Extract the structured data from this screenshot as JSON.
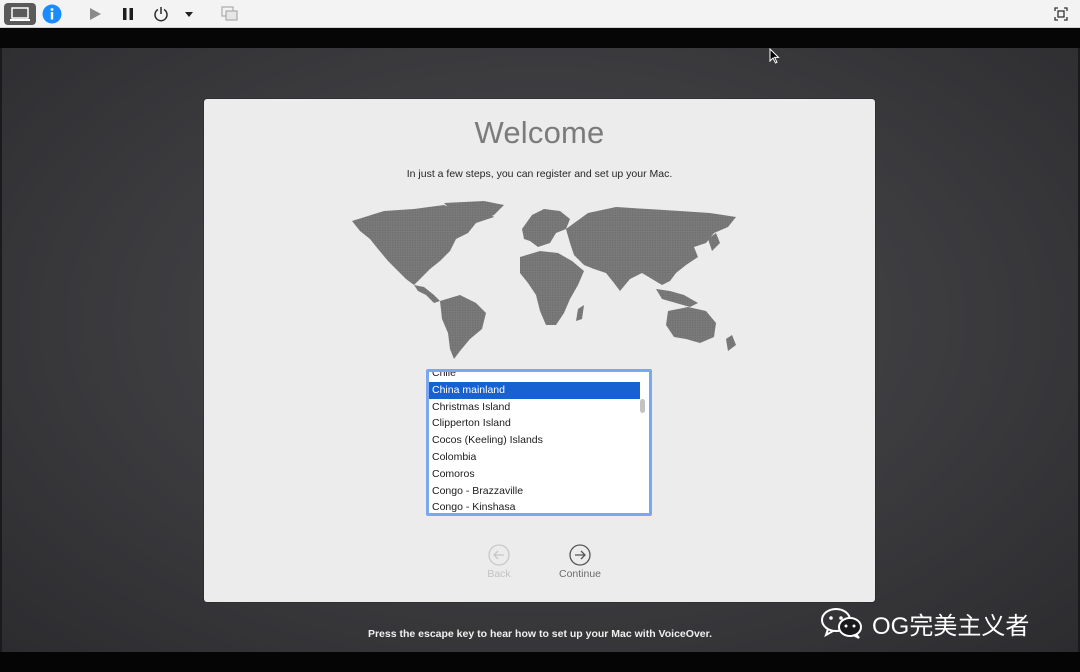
{
  "toolbar": {
    "icons": [
      "monitor-icon",
      "info-icon",
      "play-icon",
      "pause-icon",
      "power-icon",
      "caret-down-icon",
      "snapshot-icon",
      "fullscreen-icon"
    ]
  },
  "setup": {
    "title": "Welcome",
    "subtitle": "In just a few steps, you can register and set up your Mac.",
    "countries": [
      {
        "name": "Chile",
        "selected": false
      },
      {
        "name": "China mainland",
        "selected": true
      },
      {
        "name": "Christmas Island",
        "selected": false
      },
      {
        "name": "Clipperton Island",
        "selected": false
      },
      {
        "name": "Cocos (Keeling) Islands",
        "selected": false
      },
      {
        "name": "Colombia",
        "selected": false
      },
      {
        "name": "Comoros",
        "selected": false
      },
      {
        "name": "Congo - Brazzaville",
        "selected": false
      },
      {
        "name": "Congo - Kinshasa",
        "selected": false
      }
    ],
    "back_label": "Back",
    "continue_label": "Continue"
  },
  "footer": {
    "hint": "Press the escape key to hear how to set up your Mac with VoiceOver."
  },
  "watermark": {
    "text": "OG完美主义者"
  },
  "colors": {
    "selection": "#1662d3",
    "list_focus_ring": "#7aa7f0",
    "info_blue": "#1a8cff"
  }
}
